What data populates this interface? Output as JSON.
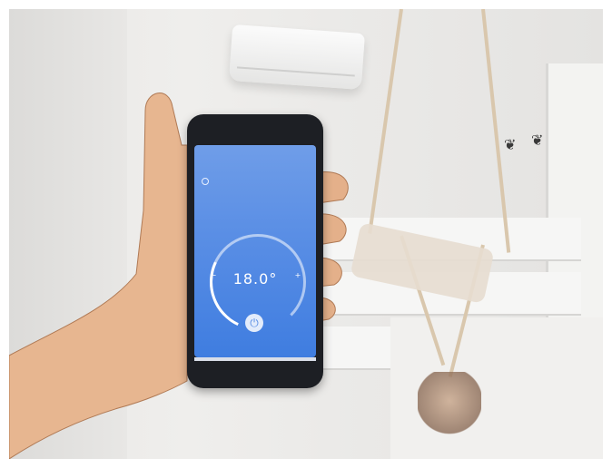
{
  "scene": {
    "description_colors": {
      "wall": "#eae9e7",
      "screen_top": "#6f9de8",
      "screen_bottom": "#3f7de0",
      "skin": "#e7b690"
    }
  },
  "phone_app": {
    "temperature": "18.0°",
    "icons": {
      "menu": "menu-icon",
      "minus": "minus-icon",
      "plus": "plus-icon",
      "power": "power-icon"
    }
  }
}
